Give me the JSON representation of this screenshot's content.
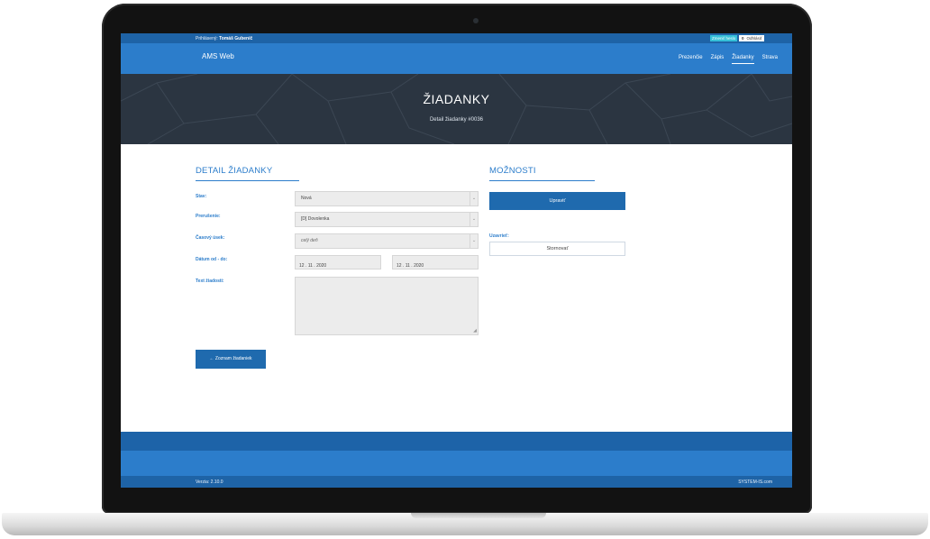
{
  "topbar": {
    "logged_prefix": "Prihlásený:",
    "user_name": "Tomáš Gubenič",
    "change_password": "Zmeniť heslo",
    "logout": "Odhlásiť",
    "logout_count": "0"
  },
  "navbar": {
    "brand": "AMS Web",
    "items": [
      "Prezenčie",
      "Zápis",
      "Žiadanky",
      "Strava"
    ],
    "active_index": 2
  },
  "hero": {
    "title": "ŽIADANKY",
    "subtitle": "Detail žiadanky #0036"
  },
  "detail": {
    "title": "DETAIL ŽIADANKY",
    "stav_label": "Stav:",
    "stav_value": "Nová",
    "prerusenie_label": "Prerušenie:",
    "prerusenie_value": "[D] Dovolenka",
    "casovy_usek_label": "Časový úsek:",
    "casovy_usek_value": "celý deň",
    "datum_label": "Dátum od - do:",
    "datum_od": "12 . 11 . 2020",
    "datum_do": "12 . 11 . 2020",
    "text_label": "Text žiadosti:",
    "text_value": "",
    "back_button": "← Zoznam žiadaniek"
  },
  "options": {
    "title": "MOŽNOSTI",
    "edit_button": "Upraviť",
    "cancel_label": "Uzavrieť:",
    "cancel_button": "Stornovať"
  },
  "footer": {
    "version": "Verzia: 2.10.0",
    "site": "SYSTEM-IS.com"
  },
  "colors": {
    "primary": "#2c7dcb",
    "dark_primary": "#1e63a6",
    "hero_bg": "#2b3541",
    "button_blue": "#1f6aae"
  }
}
